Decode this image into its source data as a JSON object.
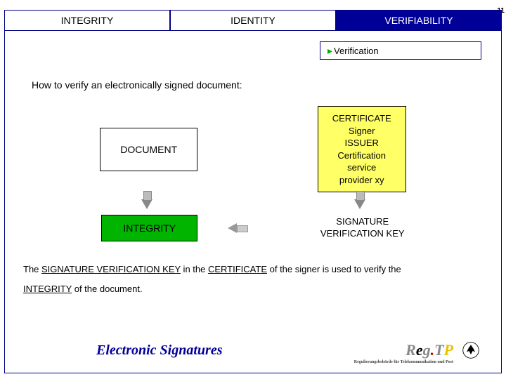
{
  "page_number": "11",
  "tabs": {
    "t1": "INTEGRITY",
    "t2": "IDENTITY",
    "t3": "VERIFIABILITY"
  },
  "sublabel": "Verification",
  "heading": "How to verify an electronically signed document:",
  "document_box": "DOCUMENT",
  "certificate_box": "CERTIFICATE\nSigner\nISSUER\nCertification\nservice\nprovider xy",
  "integrity_box": "INTEGRITY",
  "sig_key": "SIGNATURE\nVERIFICATION KEY",
  "explain_parts": {
    "p1": "The ",
    "svk": "SIGNATURE VERIFICATION KEY",
    "p2": " in the ",
    "cert": "CERTIFICATE",
    "p3": " of the signer is used to verify the",
    "integ": "INTEGRITY",
    "p4": " of the document."
  },
  "footer_title": "Electronic Signatures",
  "logo_text": "Reg.TP",
  "logo_sub": "Regulierungsbehörde für Telekommunikation und Post"
}
